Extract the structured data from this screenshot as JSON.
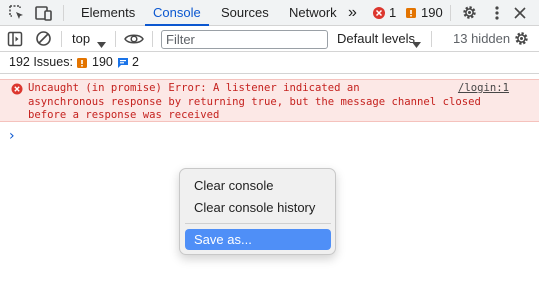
{
  "tabs": [
    {
      "label": "Elements",
      "active": false
    },
    {
      "label": "Console",
      "active": true
    },
    {
      "label": "Sources",
      "active": false
    },
    {
      "label": "Network",
      "active": false
    }
  ],
  "tabbar": {
    "more_tabs": "»",
    "error_count": "1",
    "warning_count": "190"
  },
  "toolbar": {
    "context": "top",
    "filter_placeholder": "Filter",
    "levels": "Default levels",
    "hidden": "13 hidden"
  },
  "issues": {
    "label": "192 Issues:",
    "warning_count": "190",
    "info_count": "2"
  },
  "messages": [
    {
      "level": "error",
      "text": "Uncaught (in promise) Error: A listener indicated an\nasynchronous response by returning true, but the message channel closed\nbefore a response was received",
      "source": "/login:1"
    }
  ],
  "context_menu": {
    "items": [
      "Clear console",
      "Clear console history",
      "Save as..."
    ],
    "highlighted": "Save as..."
  },
  "colors": {
    "accent": "#0b57d0",
    "error_bg": "#fce8e6",
    "error_text": "#c5221f",
    "warning": "#e37400",
    "menu_highlight": "#4f8ff7"
  },
  "icons": [
    "inspect-element-icon",
    "device-toolbar-icon",
    "sidebar-toggle-icon",
    "clear-console-icon",
    "eye-icon",
    "gear-icon",
    "kebab-menu-icon",
    "close-icon",
    "error-icon",
    "warning-icon",
    "info-message-icon",
    "chevron-right-icon",
    "dropdown-arrow-icon"
  ]
}
